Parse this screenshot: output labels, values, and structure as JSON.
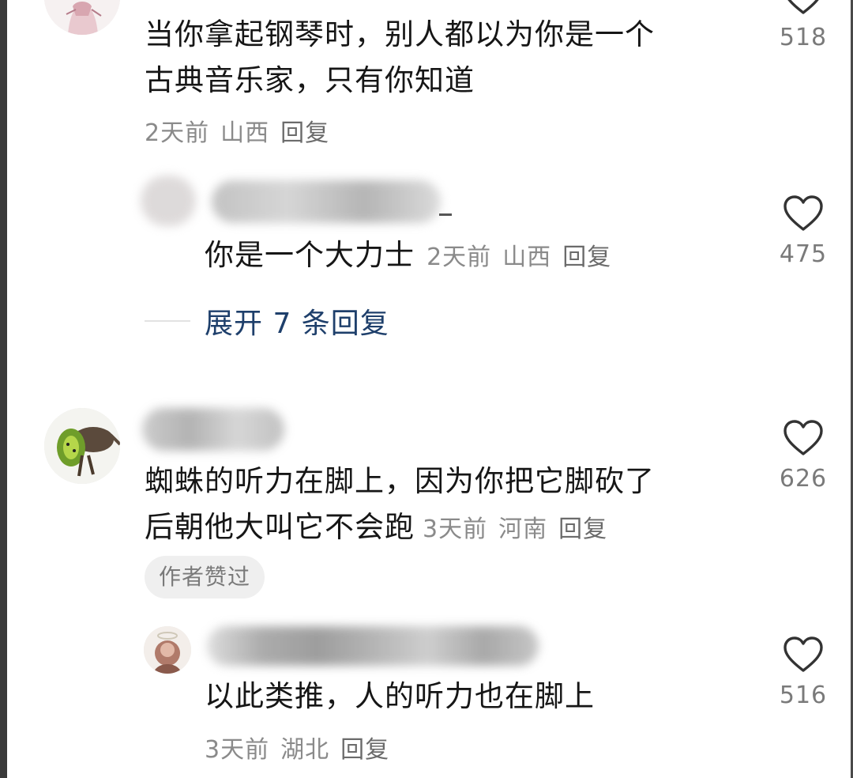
{
  "comments": [
    {
      "text_lines": [
        "当你拿起钢琴时，别人都以为你是一个",
        "古典音乐家，只有你知道"
      ],
      "time": "2天前",
      "location": "山西",
      "reply_label": "回复",
      "likes": "518",
      "replies": [
        {
          "text": "你是一个大力士",
          "time": "2天前",
          "location": "山西",
          "reply_label": "回复",
          "likes": "475"
        }
      ],
      "expand_label": "展开 7 条回复"
    },
    {
      "text_line1": "蜘蛛的听力在脚上，因为你把它脚砍了",
      "text_line2": "后朝他大叫它不会跑",
      "time": "3天前",
      "location": "河南",
      "reply_label": "回复",
      "likes": "626",
      "author_badge": "作者赞过",
      "replies": [
        {
          "text": "以此类推，人的听力也在脚上",
          "time": "3天前",
          "location": "湖北",
          "reply_label": "回复",
          "likes": "516"
        }
      ]
    }
  ],
  "icons": {
    "like": "heart-outline-icon"
  },
  "colors": {
    "text": "#161616",
    "meta": "#8a8a8a",
    "link": "#1e3f6b",
    "badge_bg": "#efefef"
  }
}
